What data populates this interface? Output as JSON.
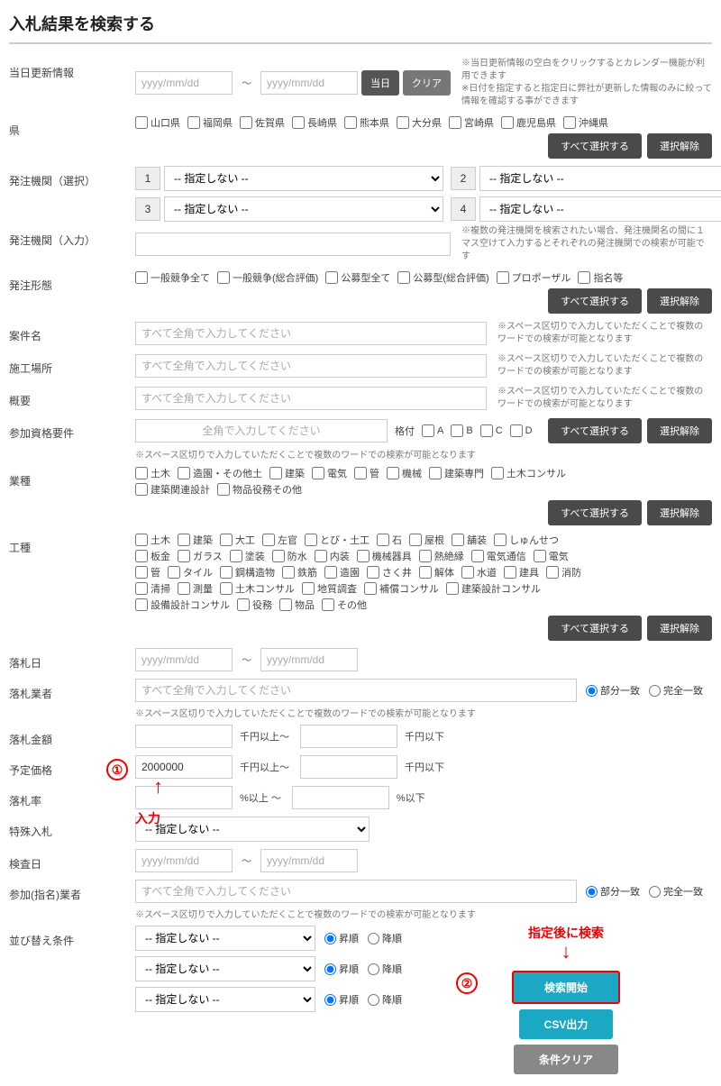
{
  "title": "入札結果を検索する",
  "date_update": {
    "label": "当日更新情報",
    "ph": "yyyy/mm/dd",
    "btn_today": "当日",
    "btn_clear": "クリア",
    "note": "※当日更新情報の空白をクリックするとカレンダー機能が利用できます\n※日付を指定すると指定日に弊社が更新した情報のみに絞って情報を確認する事ができます"
  },
  "pref": {
    "label": "県",
    "items": [
      "山口県",
      "福岡県",
      "佐賀県",
      "長崎県",
      "熊本県",
      "大分県",
      "宮崎県",
      "鹿児島県",
      "沖縄県"
    ]
  },
  "btn_select_all": "すべて選択する",
  "btn_deselect": "選択解除",
  "org_sel": {
    "label": "発注機関（選択）",
    "opt": "-- 指定しない --",
    "nums": [
      "1",
      "2",
      "3",
      "4"
    ]
  },
  "org_inp": {
    "label": "発注機関（入力）",
    "note": "※複数の発注機関を検索されたい場合、発注機関名の間に１マス空けて入力するとそれぞれの発注機関での検索が可能です"
  },
  "bid_type": {
    "label": "発注形態",
    "items": [
      "一般競争全て",
      "一般競争(総合評価)",
      "公募型全て",
      "公募型(総合評価)",
      "プロポーザル",
      "指名等"
    ]
  },
  "case_name": {
    "label": "案件名",
    "ph": "すべて全角で入力してください",
    "note": "※スペース区切りで入力していただくことで複数のワードでの検索が可能となります"
  },
  "location": {
    "label": "施工場所",
    "ph": "すべて全角で入力してください",
    "note": "※スペース区切りで入力していただくことで複数のワードでの検索が可能となります"
  },
  "summary": {
    "label": "概要",
    "ph": "すべて全角で入力してください",
    "note": "※スペース区切りで入力していただくことで複数のワードでの検索が可能となります"
  },
  "qual": {
    "label": "参加資格要件",
    "ph": "全角で入力してください",
    "grade_label": "格付",
    "grades": [
      "A",
      "B",
      "C",
      "D"
    ],
    "note": "※スペース区切りで入力していただくことで複数のワードでの検索が可能となります"
  },
  "industry": {
    "label": "業種",
    "items": [
      "土木",
      "造園・その他土",
      "建築",
      "電気",
      "管",
      "機械",
      "建築専門",
      "土木コンサル",
      "建築関連設計",
      "物品役務その他"
    ]
  },
  "work_type": {
    "label": "工種",
    "items": [
      "土木",
      "建築",
      "大工",
      "左官",
      "とび・土工",
      "石",
      "屋根",
      "舗装",
      "しゅんせつ",
      "板金",
      "ガラス",
      "塗装",
      "防水",
      "内装",
      "機械器具",
      "熱絶縁",
      "電気通信",
      "電気",
      "管",
      "タイル",
      "鋼構造物",
      "鉄筋",
      "造園",
      "さく井",
      "解体",
      "水道",
      "建具",
      "消防",
      "清掃",
      "測量",
      "土木コンサル",
      "地質調査",
      "補償コンサル",
      "建築設計コンサル",
      "設備設計コンサル",
      "役務",
      "物品",
      "その他"
    ]
  },
  "award_date": {
    "label": "落札日",
    "ph": "yyyy/mm/dd"
  },
  "award_vendor": {
    "label": "落札業者",
    "ph": "すべて全角で入力してください",
    "note": "※スペース区切りで入力していただくことで複数のワードでの検索が可能となります",
    "r1": "部分一致",
    "r2": "完全一致"
  },
  "award_amount": {
    "label": "落札金額",
    "unit1": "千円以上～",
    "unit2": "千円以下"
  },
  "est_price": {
    "label": "予定価格",
    "value": "2000000",
    "unit1": "千円以上～",
    "unit2": "千円以下"
  },
  "award_rate": {
    "label": "落札率",
    "unit1": "%以上 ～",
    "unit2": "%以下"
  },
  "special": {
    "label": "特殊入札",
    "opt": "-- 指定しない --"
  },
  "inspect_date": {
    "label": "検査日",
    "ph": "yyyy/mm/dd"
  },
  "nominate": {
    "label": "参加(指名)業者",
    "ph": "すべて全角で入力してください",
    "note": "※スペース区切りで入力していただくことで複数のワードでの検索が可能となります",
    "r1": "部分一致",
    "r2": "完全一致"
  },
  "sort": {
    "label": "並び替え条件",
    "opt": "-- 指定しない --",
    "r1": "昇順",
    "r2": "降順"
  },
  "btn_search": "検索開始",
  "btn_csv": "CSV出力",
  "btn_clear_cond": "条件クリア",
  "annot1": "①",
  "annot1_text": "入力",
  "annot2": "②",
  "annot2_text": "指定後に検索"
}
